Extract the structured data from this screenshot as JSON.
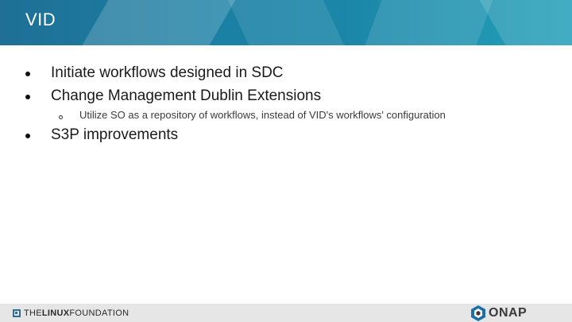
{
  "slide": {
    "title": "VID",
    "bullets": [
      {
        "level": 1,
        "text": "Initiate workflows designed in SDC"
      },
      {
        "level": 1,
        "text": "Change Management Dublin Extensions"
      },
      {
        "level": 2,
        "text": "Utilize SO as a repository of workflows, instead of VID's workflows' configuration"
      },
      {
        "level": 1,
        "text": "S3P improvements"
      }
    ]
  },
  "footer": {
    "left_logo": {
      "prefix": "THE",
      "bold": "LINUX",
      "suffix": "FOUNDATION",
      "icon": "linux-foundation-icon"
    },
    "right_logo": {
      "text": "ONAP",
      "icon": "onap-icon"
    }
  },
  "colors": {
    "title_bar": "#1a7fa3",
    "title_text": "#ffffff",
    "footer_bg": "#e6e6e6",
    "onap_blue": "#1e6fa8",
    "onap_dark": "#3a3a3a"
  }
}
